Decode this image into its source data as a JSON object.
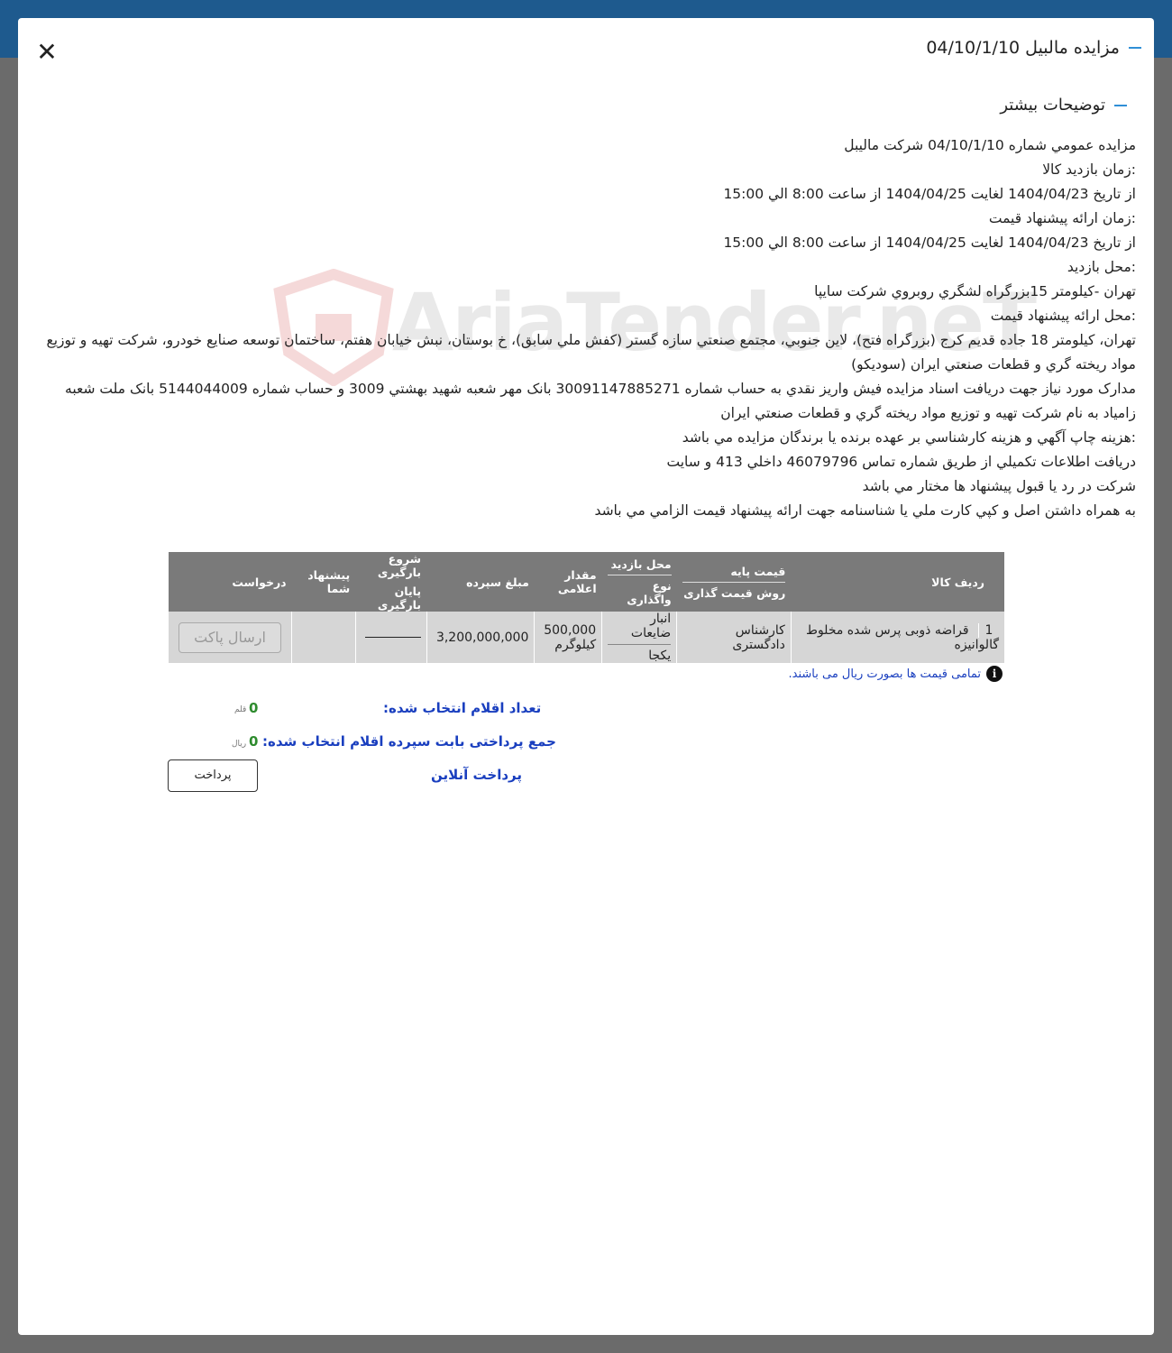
{
  "modal": {
    "title": "مزايده مالبيل 04/10/1/10",
    "section_title": "توضیحات بیشتر"
  },
  "description": {
    "lines": [
      "مزايده عمومي شماره 04/10/1/10 شركت ماليبل",
      ":زمان بازديد كالا",
      "از تاريخ 1404/04/23 لغايت 1404/04/25 از ساعت 8:00 الي 15:00",
      ":زمان ارائه پيشنهاد قيمت",
      "از تاريخ 1404/04/23 لغايت 1404/04/25 از ساعت 8:00 الي 15:00",
      ":محل بازديد",
      "تهران -كيلومتر 15بزرگراه لشگري روبروي شركت سايپا",
      ":محل ارائه پيشنهاد قيمت",
      "تهران، كيلومتر 18 جاده قديم كرج (بزرگراه فتح)، لاين جنوبي، مجتمع صنعتي سازه گستر (كفش ملي سابق)، خ بوستان، نبش خيابان هفتم، ساختمان توسعه صنايع خودرو، شركت تهيه و توزيع مواد ريخته گري و قطعات صنعتي ايران (سوديكو)",
      "مدارک مورد نياز جهت دريافت اسناد مزايده فيش واريز نقدي به حساب شماره 30091147885271 بانک مهر شعبه شهيد بهشتي 3009 و حساب شماره 5144044009 بانک ملت شعبه زامياد به نام شركت تهيه و توزيع مواد ريخته گري و قطعات صنعتي ايران",
      ":هزينه چاپ آگهي و هزينه كارشناسي بر عهده برنده يا برندگان مزايده مي باشد",
      "دريافت اطلاعات تكميلي از طريق شماره تماس 46079796 داخلي 413 و سايت",
      "شركت در رد يا قبول پيشنهاد ها مختار مي باشد",
      "به همراه داشتن اصل و کپي کارت ملي يا شناسنامه جهت ارائه پيشنهاد قيمت الزامي مي باشد"
    ]
  },
  "watermark": "AriaTender.neT",
  "table": {
    "headers": {
      "row_item": "ردیف کالا",
      "base_price": "قیمت پایه",
      "pricing_method": "روش قیمت گذاری",
      "visit_location": "محل بازدید",
      "transfer_type": "نوع واگذاری",
      "announced_qty": "مقدار اعلامی",
      "deposit": "مبلغ سپرده",
      "loading_start": "شروع بارگیری",
      "loading_end": "پایان بارگیری",
      "your_offer": "پیشنهاد شما",
      "request": "درخواست"
    },
    "rows": [
      {
        "index": "1",
        "item": "قراضه ذوبی پرس شده مخلوط گالوانیزه",
        "pricing": "کارشناس دادگستری",
        "visit_location": "انبار ضایعات",
        "transfer_type": "یکجا",
        "qty": "500,000",
        "qty_unit": "کیلوگرم",
        "deposit": "3,200,000,000",
        "send_label": "ارسال پاکت"
      }
    ]
  },
  "note": "تمامی قیمت ها بصورت ریال می باشند.",
  "summary": {
    "count_label": "تعداد اقلام انتخاب شده:",
    "count_value": "0",
    "count_unit": "قلم",
    "total_label": "جمع پرداختی بابت سپرده اقلام انتخاب شده:",
    "total_value": "0",
    "total_unit": "ریال",
    "online_label": "پرداخت آنلاین",
    "pay_label": "پرداخت"
  }
}
